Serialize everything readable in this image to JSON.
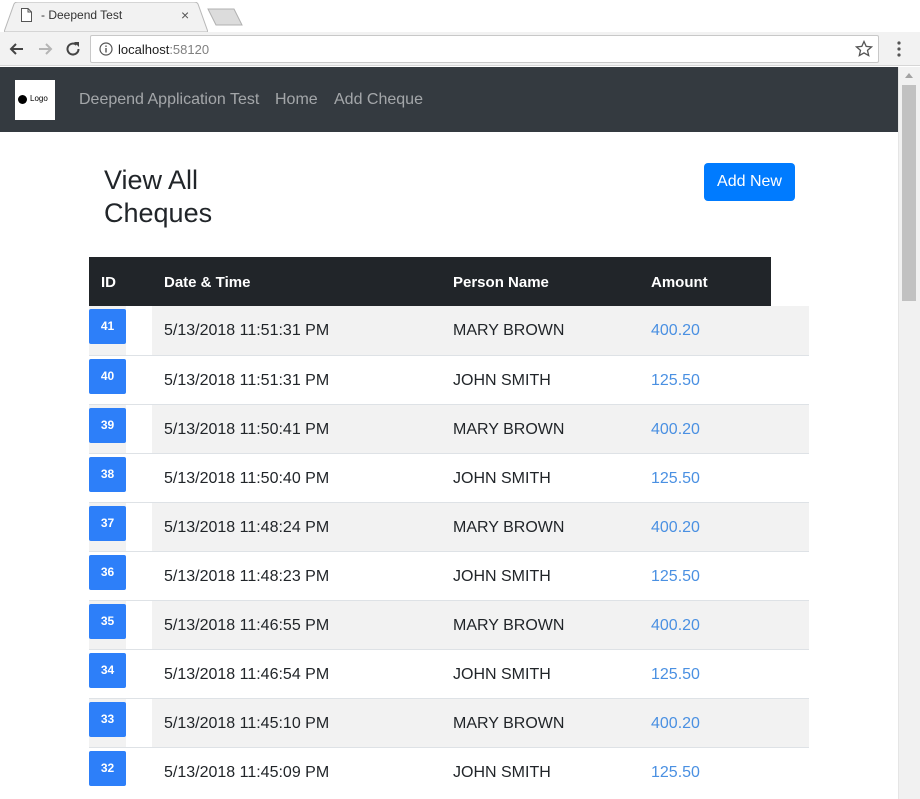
{
  "browser": {
    "tab_title": "- Deepend Test",
    "url_host": "localhost",
    "url_port": ":58120"
  },
  "navbar": {
    "logo_text": "Logo",
    "brand": "Deepend Application Test",
    "links": [
      "Home",
      "Add Cheque"
    ]
  },
  "page": {
    "title": "View All Cheques",
    "add_button": "Add New"
  },
  "table": {
    "headers": [
      "ID",
      "Date & Time",
      "Person Name",
      "Amount"
    ],
    "rows": [
      {
        "id": "41",
        "datetime": "5/13/2018 11:51:31 PM",
        "name": "MARY BROWN",
        "amount": "400.20"
      },
      {
        "id": "40",
        "datetime": "5/13/2018 11:51:31 PM",
        "name": "JOHN SMITH",
        "amount": "125.50"
      },
      {
        "id": "39",
        "datetime": "5/13/2018 11:50:41 PM",
        "name": "MARY BROWN",
        "amount": "400.20"
      },
      {
        "id": "38",
        "datetime": "5/13/2018 11:50:40 PM",
        "name": "JOHN SMITH",
        "amount": "125.50"
      },
      {
        "id": "37",
        "datetime": "5/13/2018 11:48:24 PM",
        "name": "MARY BROWN",
        "amount": "400.20"
      },
      {
        "id": "36",
        "datetime": "5/13/2018 11:48:23 PM",
        "name": "JOHN SMITH",
        "amount": "125.50"
      },
      {
        "id": "35",
        "datetime": "5/13/2018 11:46:55 PM",
        "name": "MARY BROWN",
        "amount": "400.20"
      },
      {
        "id": "34",
        "datetime": "5/13/2018 11:46:54 PM",
        "name": "JOHN SMITH",
        "amount": "125.50"
      },
      {
        "id": "33",
        "datetime": "5/13/2018 11:45:10 PM",
        "name": "MARY BROWN",
        "amount": "400.20"
      },
      {
        "id": "32",
        "datetime": "5/13/2018 11:45:09 PM",
        "name": "JOHN SMITH",
        "amount": "125.50"
      }
    ]
  },
  "colors": {
    "navbar_bg": "#343a40",
    "primary": "#007bff",
    "amount_link": "#4a90e2",
    "table_header_bg": "#212529"
  },
  "icons": [
    "page-icon",
    "close-icon",
    "back-icon",
    "forward-icon",
    "reload-icon",
    "info-icon",
    "star-icon",
    "menu-icon"
  ]
}
